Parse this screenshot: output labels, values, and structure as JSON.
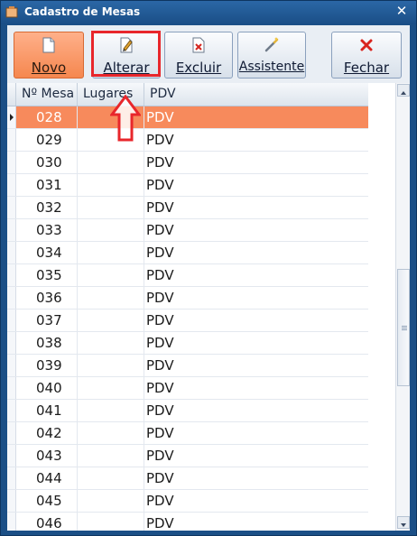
{
  "window": {
    "title": "Cadastro de Mesas",
    "close_glyph": "✕"
  },
  "toolbar": {
    "buttons": [
      {
        "label": "Novo",
        "icon": "new-document-icon"
      },
      {
        "label": "Alterar",
        "icon": "edit-pencil-icon"
      },
      {
        "label": "Excluir",
        "icon": "delete-document-icon"
      },
      {
        "label": "Assistente",
        "icon": "wizard-wand-icon"
      },
      {
        "label": "Fechar",
        "icon": "close-x-icon"
      }
    ],
    "active_button": "Novo",
    "highlight_color": "#e8262b"
  },
  "grid": {
    "columns": [
      "Nº Mesa",
      "Lugares",
      "PDV"
    ],
    "selected_row": 0,
    "selected_color": "#f78a5c",
    "rows": [
      {
        "mesa": "028",
        "lugares": "",
        "pdv": "PDV"
      },
      {
        "mesa": "029",
        "lugares": "",
        "pdv": "PDV"
      },
      {
        "mesa": "030",
        "lugares": "",
        "pdv": "PDV"
      },
      {
        "mesa": "031",
        "lugares": "",
        "pdv": "PDV"
      },
      {
        "mesa": "032",
        "lugares": "",
        "pdv": "PDV"
      },
      {
        "mesa": "033",
        "lugares": "",
        "pdv": "PDV"
      },
      {
        "mesa": "034",
        "lugares": "",
        "pdv": "PDV"
      },
      {
        "mesa": "035",
        "lugares": "",
        "pdv": "PDV"
      },
      {
        "mesa": "036",
        "lugares": "",
        "pdv": "PDV"
      },
      {
        "mesa": "037",
        "lugares": "",
        "pdv": "PDV"
      },
      {
        "mesa": "038",
        "lugares": "",
        "pdv": "PDV"
      },
      {
        "mesa": "039",
        "lugares": "",
        "pdv": "PDV"
      },
      {
        "mesa": "040",
        "lugares": "",
        "pdv": "PDV"
      },
      {
        "mesa": "041",
        "lugares": "",
        "pdv": "PDV"
      },
      {
        "mesa": "042",
        "lugares": "",
        "pdv": "PDV"
      },
      {
        "mesa": "043",
        "lugares": "",
        "pdv": "PDV"
      },
      {
        "mesa": "044",
        "lugares": "",
        "pdv": "PDV"
      },
      {
        "mesa": "045",
        "lugares": "",
        "pdv": "PDV"
      },
      {
        "mesa": "046",
        "lugares": "",
        "pdv": "PDV"
      }
    ]
  }
}
